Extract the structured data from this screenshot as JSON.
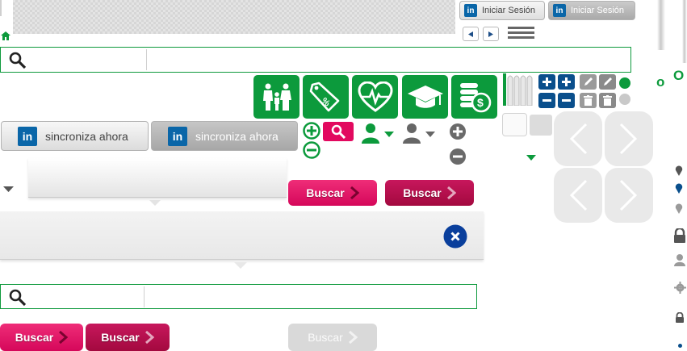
{
  "linkedin": {
    "logo": "in",
    "login_label": "Iniciar Sesión",
    "login_label_hover": "Iniciar Sesión",
    "sync_label": "sincroniza ahora",
    "sync_label_hover": "sincroniza ahora"
  },
  "search": {
    "placeholder_top": "",
    "placeholder_bottom": ""
  },
  "buttons": {
    "buscar": "Buscar",
    "buscar_hover": "Buscar",
    "buscar_bottom": "Buscar",
    "buscar_bottom_hover": "Buscar",
    "buscar_disabled": "Buscar"
  },
  "sidebar_edge": {
    "letter_left": "o",
    "letter_right": "O"
  },
  "colors": {
    "green": "#0c9a3c",
    "pink": "#e2095f",
    "pink_dark": "#b00c4a",
    "navy": "#0a4f8c",
    "gray": "#8a8a8a",
    "linkedin_blue": "#0a66a8"
  },
  "icons": [
    "home-icon",
    "search-icon",
    "family-icon",
    "discount-tag-icon",
    "heart-pulse-icon",
    "graduation-cap-icon",
    "coins-icon",
    "user-icon",
    "plus-icon",
    "minus-icon",
    "pencil-icon",
    "trash-icon",
    "close-icon",
    "chevron-left-icon",
    "chevron-right-icon",
    "map-pin-icon",
    "lock-icon",
    "gear-icon",
    "menu-icon"
  ]
}
